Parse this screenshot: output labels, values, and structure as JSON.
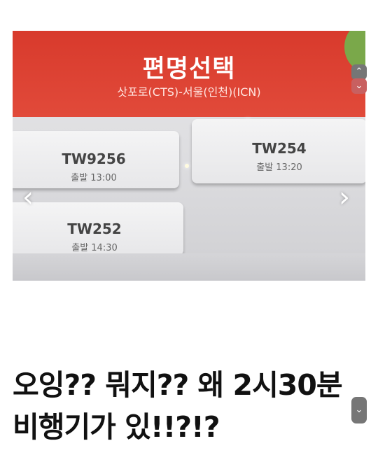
{
  "photo": {
    "title": "편명선택",
    "route": "삿포로(CTS)-서울(인천)(ICN)",
    "flights": [
      {
        "code": "TW9256",
        "time": "출발 13:00"
      },
      {
        "code": "TW254",
        "time": "출발 13:20"
      },
      {
        "code": "TW252",
        "time": "출발 14:30"
      }
    ],
    "nav": {
      "prev": "‹",
      "next": "›"
    }
  },
  "text": {
    "line1": "오잉?? 뭐지?? 왜 2시30분",
    "line2": "비행기가 있!!?!?"
  },
  "scroll": {
    "up": "⌃",
    "down": "⌄"
  },
  "colors": {
    "header_red": "#d83a2c",
    "text_dark": "#111111"
  }
}
